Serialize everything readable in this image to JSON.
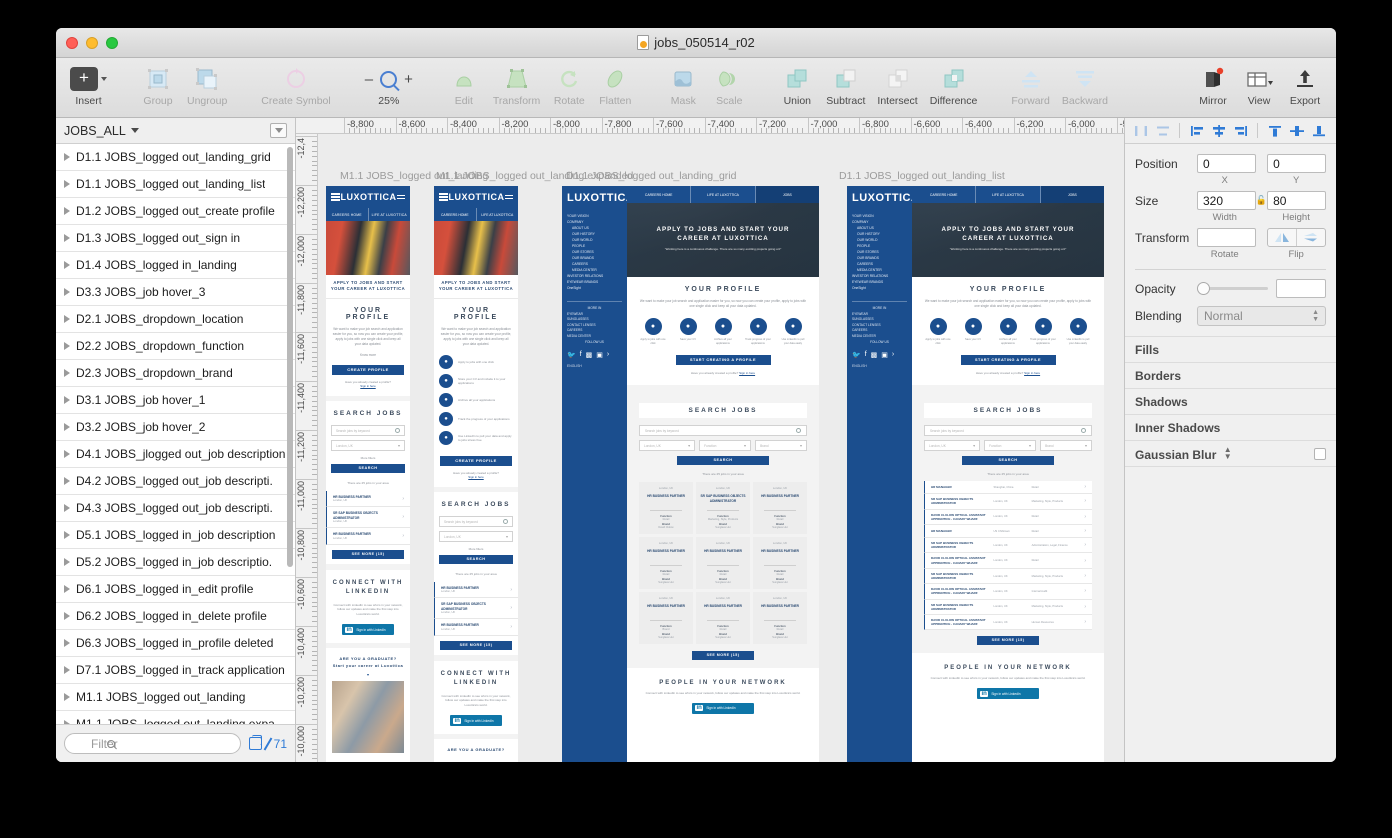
{
  "window": {
    "document_title": "jobs_050514_r02"
  },
  "toolbar": {
    "insert": "Insert",
    "group": "Group",
    "ungroup": "Ungroup",
    "create_symbol": "Create Symbol",
    "zoom_level": "25%",
    "zoom_out": "–",
    "zoom_in": "+",
    "edit": "Edit",
    "transform": "Transform",
    "rotate": "Rotate",
    "flatten": "Flatten",
    "mask": "Mask",
    "scale": "Scale",
    "union": "Union",
    "subtract": "Subtract",
    "intersect": "Intersect",
    "difference": "Difference",
    "forward": "Forward",
    "backward": "Backward",
    "mirror": "Mirror",
    "view": "View",
    "export": "Export"
  },
  "left_panel": {
    "page_name": "JOBS_ALL",
    "filter_placeholder": "Filter",
    "layer_count": "71",
    "layers": [
      "D1.1 JOBS_logged out_landing_grid",
      "D1.1 JOBS_logged out_landing_list",
      "D1.2 JOBS_logged out_create profile",
      "D1.3 JOBS_logged out_sign in",
      "D1.4 JOBS_logged in_landing",
      "D3.3 JOBS_job hover_3",
      "D2.1 JOBS_dropdown_location",
      "D2.2 JOBS_dropdown_function",
      "D2.3 JOBS_dropdown_brand",
      "D3.1 JOBS_job hover_1",
      "D3.2 JOBS_job hover_2",
      "D4.1 JOBS_jlogged out_job description",
      "D4.2 JOBS_logged out_job descripti.",
      "D4.3 JOBS_logged out_job descripti.",
      "D5.1 JOBS_logged in_job description",
      "D5.2 JOBS_logged in_job descriptio.",
      "D6.1 JOBS_logged in_edit profile",
      "D6.2 JOBS_logged in_delete profile",
      "D6.3 JOBS_logged in_profile deleted",
      "D7.1 JOBS_logged in_track application",
      "M1.1 JOBS_logged out_landing",
      "M1.1 JOBS_logged out_landing expa"
    ]
  },
  "rulers": {
    "horizontal_labels": [
      "-8,800",
      "-8,600",
      "-8,400",
      "-8,200",
      "-8,000",
      "-7,800",
      "-7,600",
      "-7,400",
      "-7,200",
      "-7,000",
      "-6,800",
      "-6,600",
      "-6,400",
      "-6,200",
      "-6,000",
      "-5,8"
    ],
    "vertical_labels": [
      "-12,4",
      "-12,200",
      "-12,000",
      "-11,800",
      "-11,600",
      "-11,400",
      "-11,200",
      "-11,000",
      "-10,800",
      "-10,600",
      "-10,400",
      "-10,200",
      "-10,000"
    ]
  },
  "inspector": {
    "position_label": "Position",
    "position_x": "0",
    "position_y": "0",
    "x_sub": "X",
    "y_sub": "Y",
    "size_label": "Size",
    "width": "320",
    "height": "80",
    "width_sub": "Width",
    "height_sub": "Height",
    "transform_label": "Transform",
    "rotate_value": "",
    "rotate_sub": "Rotate",
    "flip_sub": "Flip",
    "opacity_label": "Opacity",
    "opacity_value": "",
    "blending_label": "Blending",
    "blending_value": "Normal",
    "sections": [
      "Fills",
      "Borders",
      "Shadows",
      "Inner Shadows"
    ],
    "gaussian_blur": "Gaussian Blur"
  },
  "canvas": {
    "artboard_titles": [
      "M1.1 JOBS_logged out_landing",
      "M1.1 JOBS_logged out_landing expanded",
      "D1.1 JOBS_logged out_landing_grid",
      "D1.1 JOBS_logged out_landing_list"
    ]
  },
  "site": {
    "brand": "LUXOTTICA",
    "nav": [
      "CAREERS HOME",
      "LIFE AT LUXOTTICA",
      "JOBS"
    ],
    "hero_title_line1": "APPLY TO JOBS AND START YOUR",
    "hero_title_line2": "CAREER AT LUXOTTICA",
    "hero_title_mob_line1": "APPLY TO JOBS AND START",
    "hero_title_mob_line2": "YOUR CAREER AT LUXOTTICA",
    "hero_sub": "“Working here is a continuous challenge. There are so many exciting projects going on!”",
    "profile_heading": "YOUR PROFILE",
    "profile_body": "We want to make your job search and application easier for you, so now you can create your profile, apply to jobs with one single click and keep all your data updated.",
    "know_more": "Know more",
    "create_profile_btn": "CREATE PROFILE",
    "start_creating_btn": "START CREATING A PROFILE",
    "already_profile": "Have you already created a profile?",
    "sign_in_here": "Sign in here",
    "benefits": [
      "Apply to jobs with one click",
      "Store your CV and include it to your applications",
      "Archive all your applications",
      "Track the progress of your applications",
      "Use LinkedIn to pull your data and apply to jobs stress free"
    ],
    "benefits_short": [
      "Apply to jobs with one click",
      "Save your CV",
      "Archive all your applications",
      "Track progress of your applications",
      "Use LinkedIn to pull your data easily"
    ],
    "search_heading": "SEARCH JOBS",
    "search_placeholder": "Search jobs by keyword",
    "filter_location": "London, UK",
    "filter_function": "Function",
    "filter_brand": "Brand",
    "more_filters": "More filters",
    "search_btn": "SEARCH",
    "results_count": "There are 25 jobs in your area",
    "see_more_btn": "SEE MORE (15)",
    "connect_linkedin_l1": "CONNECT WITH",
    "connect_linkedin_l2": "LINKEDIN",
    "people_network": "PEOPLE IN YOUR NETWORK",
    "network_body": "Connect with LinkedIn to see who's in your network, follow our updates and make the first step into Luxottica's world.",
    "linkedin_btn": "Sign in with LinkedIn",
    "graduate_l1": "ARE YOU A GRADUATE?",
    "graduate_l2": "Start your career at Luxottica",
    "card_function_label": "Function",
    "card_brand_label": "Brand",
    "sidebar_links": [
      "YOUR VISION",
      "COMPANY",
      "ABOUT US",
      "OUR HISTORY",
      "OUR WORLD",
      "PEOPLE",
      "OUR STORES",
      "OUR BRANDS",
      "CAREERS",
      "MEDIA CENTER",
      "INVESTOR RELATIONS",
      "EYEWEAR BRANDS",
      "OneSight"
    ],
    "sidebar_sections": [
      "MORE IN",
      "EYEWEAR",
      "SUNGLASSES",
      "CONTACT LENSES",
      "CAREERS",
      "MEDIA CENTER",
      "FOLLOW US",
      "ENGLISH"
    ],
    "jobs_list": [
      {
        "title": "HR MANAGER",
        "location": "Shanghai, China",
        "function": "Retail"
      },
      {
        "title": "SR SAP BUSINESS OBJECTS ADMINISTRATOR",
        "location": "London, UK",
        "function": "Marketing, Style, Products"
      },
      {
        "title": "DAVID CLULOW OPTICAL ASSISTANT APPRENTICE - CANARY WHARF",
        "location": "London, UK",
        "function": "Retail"
      },
      {
        "title": "HR MANAGER",
        "location": "US Chibitown",
        "function": "Retail"
      },
      {
        "title": "SR SAP BUSINESS OBJECTS ADMINISTRATOR",
        "location": "London, UK",
        "function": "Administration, Legal, Finance"
      },
      {
        "title": "DAVID CLULOW OPTICAL ASSISTANT APPRENTICE - CANARY WHARF",
        "location": "London, UK",
        "function": "Retail"
      },
      {
        "title": "SR SAP BUSINESS OBJECTS ADMINISTRATOR",
        "location": "London, UK",
        "function": "Marketing, Style, Products"
      },
      {
        "title": "DAVID CLULOW OPTICAL ASSISTANT APPRENTICE - CANARY WHARF",
        "location": "London, UK",
        "function": "Internal Audit"
      },
      {
        "title": "SR SAP BUSINESS OBJECTS ADMINISTRATOR",
        "location": "London, UK",
        "function": "Marketing, Style, Products"
      },
      {
        "title": "DAVID CLULOW OPTICAL ASSISTANT APPRENTICE - CANARY WHARF",
        "location": "London, UK",
        "function": "Human Resources"
      }
    ],
    "jobs_list_mobile": [
      {
        "title": "HR BUSINESS PARTNER",
        "location": "London, UK"
      },
      {
        "title": "SR SAP BUSINESS OBJECTS ADMINISTRATOR",
        "location": "London, UK"
      },
      {
        "title": "HR BUSINESS PARTNER",
        "location": "London, UK"
      }
    ],
    "jobs_grid": [
      {
        "location": "London, UK",
        "title": "HR BUSINESS PARTNER",
        "function": "Retail",
        "brand": "David Clulow"
      },
      {
        "location": "London, UK",
        "title": "SR SAP BUSINESS OBJECTS ADMINISTRATOR",
        "function": "Marketing, Style, Products",
        "brand": "Sunglass Hut"
      },
      {
        "location": "London, UK",
        "title": "HR BUSINESS PARTNER",
        "function": "Retail",
        "brand": "Sunglass Hut"
      },
      {
        "location": "London, UK",
        "title": "HR BUSINESS PARTNER",
        "function": "Retail",
        "brand": "Sunglass Hut"
      },
      {
        "location": "London, UK",
        "title": "HR BUSINESS PARTNER",
        "function": "Retail",
        "brand": "Sunglass Hut"
      },
      {
        "location": "London, UK",
        "title": "HR BUSINESS PARTNER",
        "function": "Retail",
        "brand": "Sunglass Hut"
      },
      {
        "location": "London, UK",
        "title": "HR BUSINESS PARTNER",
        "function": "Brand",
        "brand": "Sunglass Hut"
      },
      {
        "location": "London, UK",
        "title": "HR BUSINESS PARTNER",
        "function": "Retail",
        "brand": "Sunglass Hut"
      },
      {
        "location": "London, UK",
        "title": "HR BUSINESS PARTNER",
        "function": "Retail",
        "brand": "Sunglass Hut"
      }
    ]
  },
  "colors": {
    "brand_blue": "#1b4e8e",
    "accent_blue": "#2f7bd6",
    "toolbar_green": "#9fcf9f",
    "mirror_red": "#e8402a"
  }
}
